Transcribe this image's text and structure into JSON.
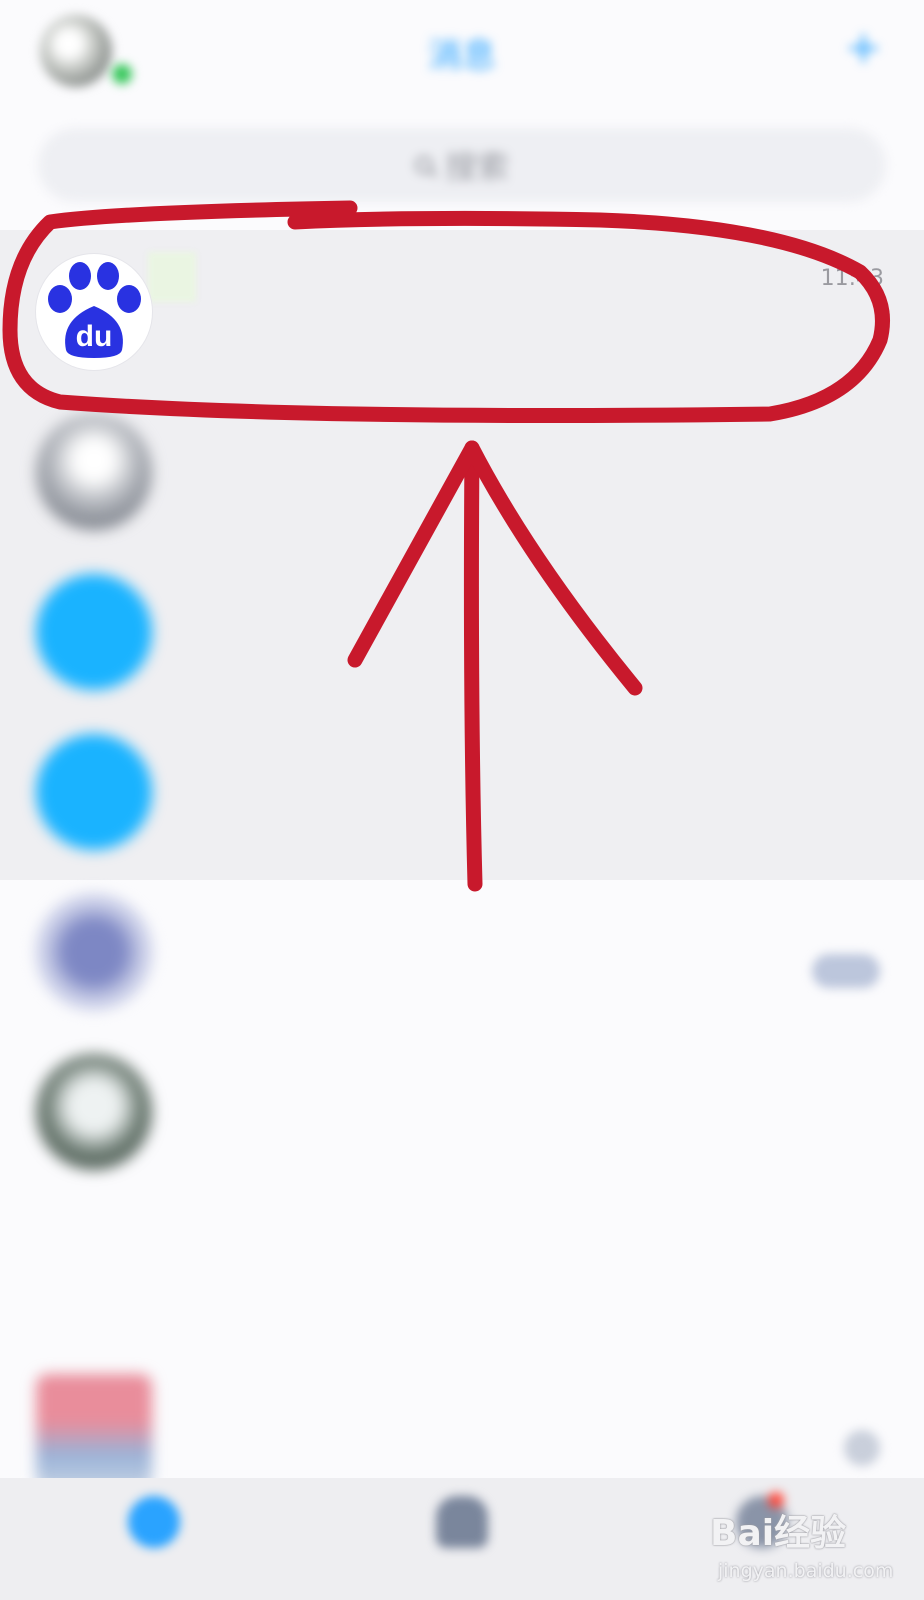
{
  "header": {
    "title": "消息",
    "plus_glyph": "+",
    "online_status_color": "#38c75c"
  },
  "search": {
    "placeholder": "搜索",
    "icon": "search-icon"
  },
  "conversations": [
    {
      "name": "",
      "preview": "",
      "time": "11:43",
      "avatar": "baidu-paw-icon",
      "pinned": true
    },
    {
      "name": "",
      "preview": "",
      "time": "",
      "pinned": true
    },
    {
      "name": "",
      "preview": "",
      "time": "",
      "pinned": true
    },
    {
      "name": "",
      "preview": "",
      "time": "",
      "pinned": true
    },
    {
      "name": "",
      "preview": "",
      "time": ""
    },
    {
      "name": "",
      "preview": "",
      "time": ""
    },
    {
      "name": "",
      "preview": "",
      "time": ""
    },
    {
      "name": "",
      "preview": "",
      "time": ""
    }
  ],
  "tabbar": {
    "active_color": "#2aa3ff"
  },
  "watermark": {
    "brand": "Bai经验",
    "url": "jingyan.baidu.com"
  },
  "baidu_avatar_text": "du",
  "colors": {
    "accent": "#2aa3ff",
    "annotation_red": "#c8192c",
    "baidu_blue": "#2932e1",
    "pinned_bg": "#efeff2"
  }
}
